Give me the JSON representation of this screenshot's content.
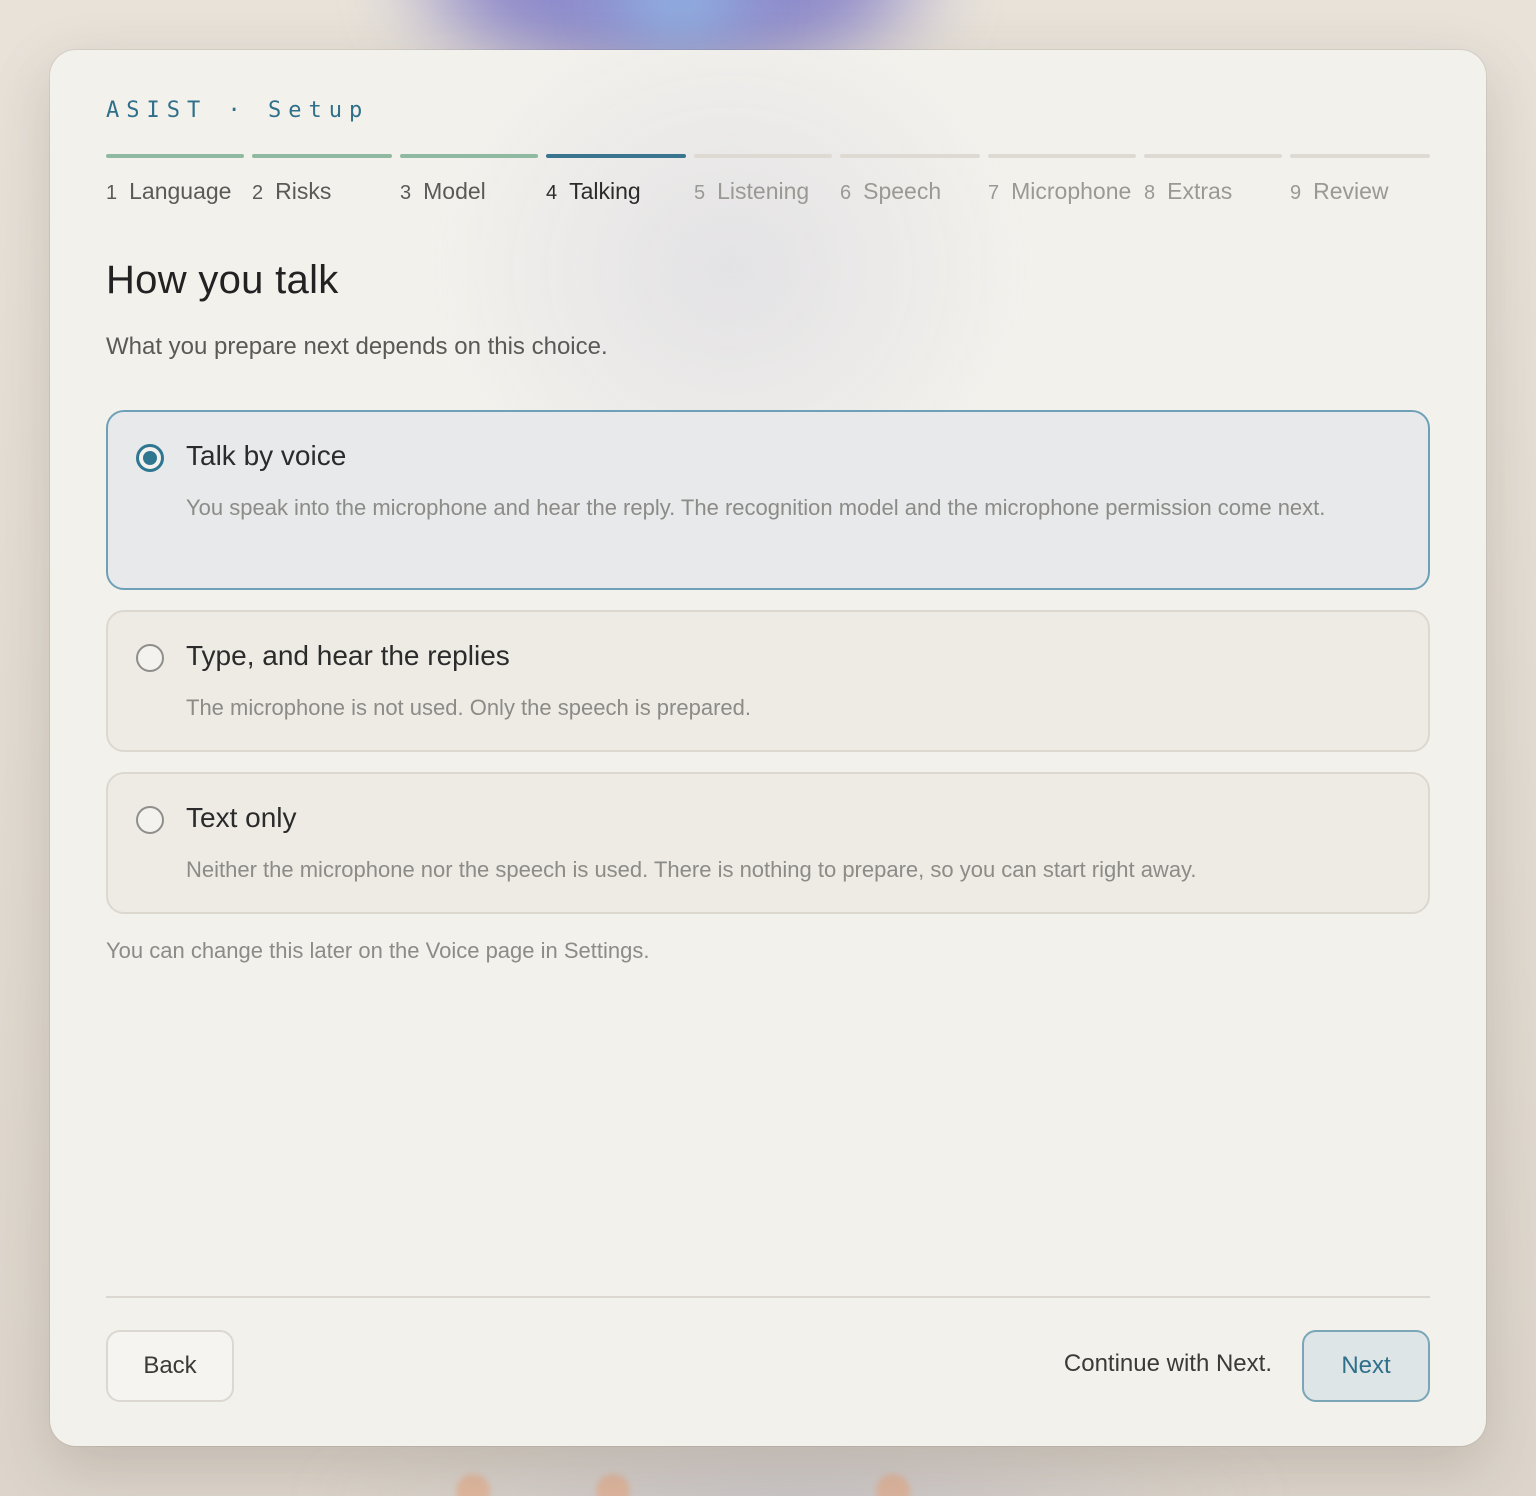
{
  "app": {
    "brand": "ASIST · Setup"
  },
  "steps": [
    {
      "number": "1",
      "label": "Language",
      "state": "done"
    },
    {
      "number": "2",
      "label": "Risks",
      "state": "done"
    },
    {
      "number": "3",
      "label": "Model",
      "state": "done"
    },
    {
      "number": "4",
      "label": "Talking",
      "state": "current"
    },
    {
      "number": "5",
      "label": "Listening",
      "state": "upcoming"
    },
    {
      "number": "6",
      "label": "Speech",
      "state": "upcoming"
    },
    {
      "number": "7",
      "label": "Microphone",
      "state": "upcoming"
    },
    {
      "number": "8",
      "label": "Extras",
      "state": "upcoming"
    },
    {
      "number": "9",
      "label": "Review",
      "state": "upcoming"
    }
  ],
  "page": {
    "title": "How you talk",
    "subtitle": "What you prepare next depends on this choice."
  },
  "options": [
    {
      "title": "Talk by voice",
      "description": "You speak into the microphone and hear the reply. The recognition model and the microphone permission come next.",
      "selected": true
    },
    {
      "title": "Type, and hear the replies",
      "description": "The microphone is not used. Only the speech is prepared.",
      "selected": false
    },
    {
      "title": "Text only",
      "description": "Neither the microphone nor the speech is used. There is nothing to prepare, so you can start right away.",
      "selected": false
    }
  ],
  "hint": "You can change this later on the Voice page in Settings.",
  "footer": {
    "back_label": "Back",
    "continue_text": "Continue with Next.",
    "next_label": "Next"
  },
  "colors": {
    "accent": "#2f7691",
    "step_done": "#8fb9a0",
    "step_current": "#3a7590",
    "step_upcoming": "#dedad3"
  }
}
